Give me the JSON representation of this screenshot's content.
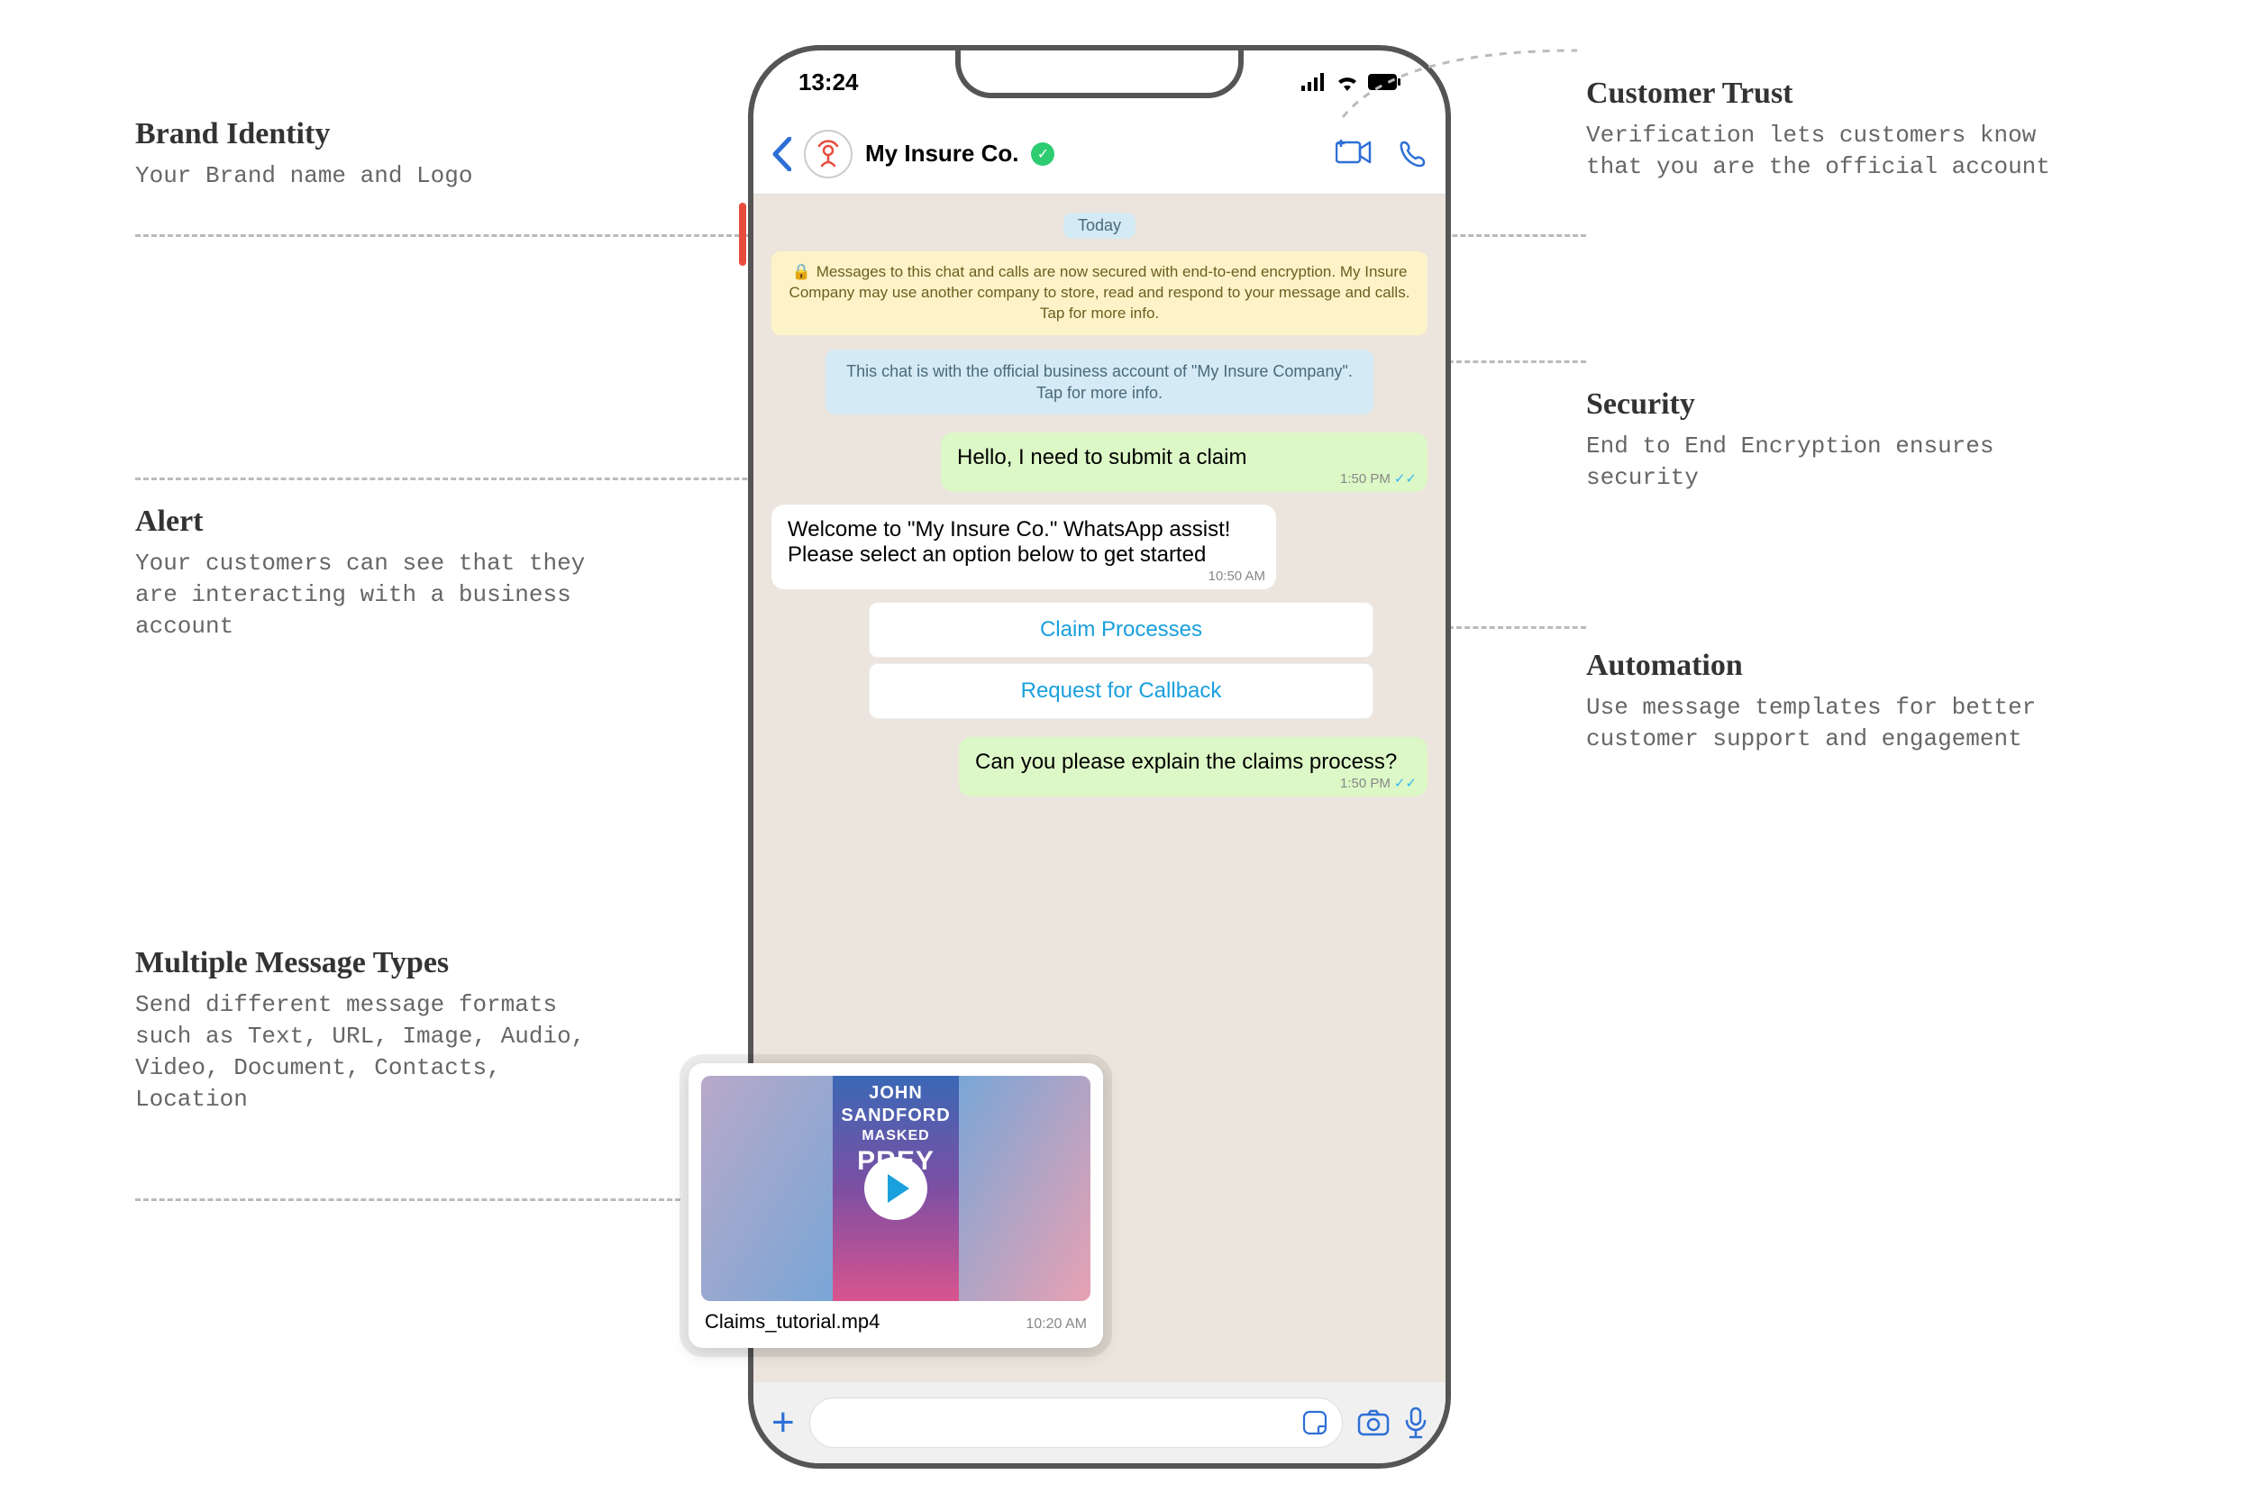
{
  "annotations": {
    "brand_identity": {
      "title": "Brand Identity",
      "desc": "Your Brand name and Logo"
    },
    "alert": {
      "title": "Alert",
      "desc": "Your customers can see that they are interacting with a business account"
    },
    "multiple": {
      "title": "Multiple Message Types",
      "desc": "Send different message formats such as Text, URL, Image, Audio, Video, Document, Contacts, Location"
    },
    "trust": {
      "title": "Customer Trust",
      "desc": "Verification lets customers know that you are the official account"
    },
    "security": {
      "title": "Security",
      "desc": "End to End Encryption ensures security"
    },
    "automation": {
      "title": "Automation",
      "desc": "Use message templates for better customer support and engagement"
    }
  },
  "phone": {
    "status_time": "13:24",
    "header": {
      "brand_name": "My Insure Co."
    },
    "date_label": "Today",
    "encryption_notice": "Messages to this chat and calls are now secured with end-to-end encryption. My Insure Company may use another company to store, read and respond to your message and calls. Tap for more info.",
    "business_notice": "This chat is with the official business account of \"My Insure Company\". Tap for more info.",
    "messages": {
      "user1": {
        "text": "Hello, I need to submit a claim",
        "time": "1:50 PM"
      },
      "bot1": {
        "text": "Welcome to \"My Insure Co.\" WhatsApp assist! Please select an option below to get started",
        "time": "10:50 AM"
      },
      "opt1": "Claim Processes",
      "opt2": "Request for Callback",
      "user2": {
        "text": "Can you please explain the claims process?",
        "time": "1:50 PM"
      }
    },
    "attachment": {
      "filename": "Claims_tutorial.mp4",
      "time": "10:20 AM",
      "book_lines": [
        "JOHN",
        "SANDFORD",
        "MASKED",
        "PREY"
      ]
    }
  }
}
